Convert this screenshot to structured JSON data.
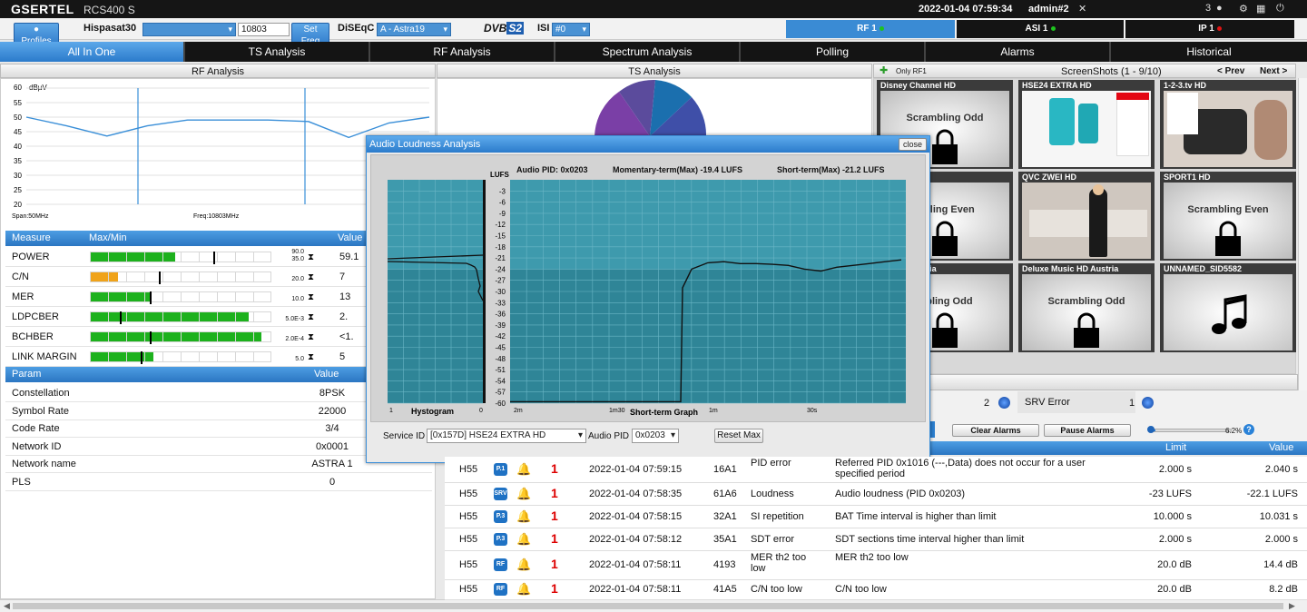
{
  "header": {
    "brand": "GSERTEL",
    "model": "RCS400 S",
    "datetime": "2022-01-04 07:59:34",
    "user": "admin#2",
    "notif_count": "3"
  },
  "toolbar": {
    "profiles": "Profiles",
    "satellite": "Hispasat30",
    "freq_value": "10803",
    "set_freq": "Set Freq",
    "diseqc_label": "DiSEqC",
    "diseqc_value": "A - Astra19",
    "dvb_label": "DVB",
    "dvb_version": "S2",
    "isi_label": "ISI",
    "isi_value": "#0"
  },
  "status_tabs": [
    {
      "label": "RF 1",
      "dot": "#1ec41e"
    },
    {
      "label": "ASI 1",
      "dot": "#1ec41e"
    },
    {
      "label": "IP 1",
      "dot": "#e01414"
    }
  ],
  "nav": [
    "All In One",
    "TS Analysis",
    "RF Analysis",
    "Spectrum Analysis",
    "Polling",
    "Alarms",
    "Historical"
  ],
  "rf": {
    "title": "RF Analysis",
    "y_unit": "dBµV",
    "y_ticks": [
      "60",
      "55",
      "50",
      "45",
      "40",
      "35",
      "30",
      "25",
      "20"
    ],
    "span": "Span:50MHz",
    "freq": "Freq:10803MHz",
    "measure_hdr": "Measure",
    "maxmin_hdr": "Max/Min",
    "value_hdr": "Value",
    "measures": [
      {
        "name": "POWER",
        "max": "90.0",
        "min": "35.0",
        "value": "59.1",
        "fill": 0.47,
        "color": "#1db11d",
        "mark": 0.68
      },
      {
        "name": "C/N",
        "max": "",
        "min": "20.0",
        "value": "7",
        "fill": 0.15,
        "color": "#f0a31a",
        "mark": 0.38
      },
      {
        "name": "MER",
        "max": "",
        "min": "10.0",
        "value": "13",
        "fill": 0.33,
        "color": "#1db11d",
        "mark": 0.33
      },
      {
        "name": "LDPCBER",
        "max": "",
        "min": "5.0E-3",
        "value": "2.",
        "fill": 0.88,
        "color": "#1db11d",
        "mark": 0.16
      },
      {
        "name": "BCHBER",
        "max": "",
        "min": "2.0E-4",
        "value": "<1.",
        "fill": 0.95,
        "color": "#1db11d",
        "mark": 0.33
      },
      {
        "name": "LINK MARGIN",
        "max": "",
        "min": "5.0",
        "value": "5",
        "fill": 0.35,
        "color": "#1db11d",
        "mark": 0.28
      }
    ],
    "param_hdr": "Param",
    "pvalue_hdr": "Value",
    "params": [
      {
        "name": "Constellation",
        "value": "8PSK"
      },
      {
        "name": "Symbol Rate",
        "value": "22000"
      },
      {
        "name": "Code Rate",
        "value": "3/4"
      },
      {
        "name": "Network ID",
        "value": "0x0001"
      },
      {
        "name": "Network name",
        "value": "ASTRA 1"
      },
      {
        "name": "PLS",
        "value": "0"
      }
    ]
  },
  "ts": {
    "title": "TS Analysis"
  },
  "screens": {
    "only_rf": "Only RF1",
    "title": "ScreenShots (1 - 9/10)",
    "prev": "< Prev",
    "next": "Next >",
    "thumbs": [
      {
        "name": "Disney Channel HD",
        "text": "Scrambling Odd",
        "kind": "lock"
      },
      {
        "name": "HSE24 EXTRA HD",
        "text": "",
        "kind": "shop"
      },
      {
        "name": "1-2-3.tv HD",
        "text": "",
        "kind": "shop2"
      },
      {
        "name": "c HD",
        "text": "mbling Even",
        "kind": "lock"
      },
      {
        "name": "QVC ZWEI HD",
        "text": "",
        "kind": "qvc"
      },
      {
        "name": "SPORT1 HD",
        "text": "Scrambling Even",
        "kind": "lock"
      },
      {
        "name": "nel HD Austria",
        "text": "mbling Odd",
        "kind": "lock"
      },
      {
        "name": "Deluxe Music HD Austria",
        "text": "Scrambling Odd",
        "kind": "lock"
      },
      {
        "name": "UNNAMED_SID5582",
        "text": "",
        "kind": "music"
      }
    ]
  },
  "alarm_panel": {
    "count_a": "2",
    "srv_error": "SRV Error",
    "count_b": "1",
    "clear": "Clear Alarms",
    "pause": "Pause Alarms",
    "percent": "6.2%",
    "limit_hdr": "Limit",
    "value_hdr": "Value",
    "rows": [
      {
        "id": "H55",
        "badge": "P.1",
        "bell": "red",
        "count": "1",
        "time": "2022-01-04 07:59:15",
        "code": "16A1",
        "type": "PID error",
        "desc": "Referred PID 0x1016 (---,Data) does not occur for a user specified period",
        "limit": "2.000 s",
        "value": "2.040 s"
      },
      {
        "id": "H55",
        "badge": "SRV",
        "bell": "blue",
        "count": "1",
        "time": "2022-01-04 07:58:35",
        "code": "61A6",
        "type": "Loudness",
        "desc": "Audio loudness (PID 0x0203)",
        "limit": "-23 LUFS",
        "value": "-22.1 LUFS"
      },
      {
        "id": "H55",
        "badge": "P.3",
        "bell": "blue",
        "count": "1",
        "time": "2022-01-04 07:58:15",
        "code": "32A1",
        "type": "SI repetition",
        "desc": "BAT Time interval is higher than limit",
        "limit": "10.000 s",
        "value": "10.031 s"
      },
      {
        "id": "H55",
        "badge": "P.3",
        "bell": "blue",
        "count": "1",
        "time": "2022-01-04 07:58:12",
        "code": "35A1",
        "type": "SDT error",
        "desc": "SDT sections time interval higher than limit",
        "limit": "2.000 s",
        "value": "2.000 s"
      },
      {
        "id": "H55",
        "badge": "RF",
        "bell": "yellow",
        "count": "1",
        "time": "2022-01-04 07:58:11",
        "code": "4193",
        "type": "MER th2 too low",
        "desc": "MER th2 too low",
        "limit": "20.0 dB",
        "value": "14.4 dB"
      },
      {
        "id": "H55",
        "badge": "RF",
        "bell": "yellow",
        "count": "1",
        "time": "2022-01-04 07:58:11",
        "code": "41A5",
        "type": "C/N too low",
        "desc": "C/N too low",
        "limit": "20.0 dB",
        "value": "8.2 dB"
      }
    ]
  },
  "modal": {
    "title": "Audio Loudness Analysis",
    "close": "close",
    "audio_pid": "Audio PID: 0x0203",
    "momentary": "Momentary-term(Max) -19.4 LUFS",
    "short": "Short-term(Max) -21.2 LUFS",
    "lufs": "LUFS",
    "y_ticks": [
      "-3",
      "-6",
      "-9",
      "-12",
      "-15",
      "-18",
      "-21",
      "-24",
      "-27",
      "-30",
      "-33",
      "-36",
      "-39",
      "-42",
      "-45",
      "-48",
      "-51",
      "-54",
      "-57",
      "-60"
    ],
    "hist_left": "1",
    "hist_title": "Hystogram",
    "hist_right": "0",
    "x_labels": [
      "2m",
      "1m30",
      "1m",
      "30s"
    ],
    "graph_title": "Short-term Graph",
    "service_label": "Service ID",
    "service_value": "[0x157D] HSE24 EXTRA HD",
    "audio_label": "Audio PID",
    "audio_value": "0x0203",
    "reset": "Reset Max"
  },
  "chart_data": [
    {
      "type": "line",
      "title": "RF Analysis",
      "ylabel": "dBµV",
      "ylim": [
        20,
        60
      ],
      "x": [
        0,
        5,
        10,
        15,
        20,
        25,
        30,
        35,
        40,
        45,
        50
      ],
      "series": [
        {
          "values": [
            50,
            47,
            43.5,
            47,
            49,
            49,
            49,
            48.5,
            43,
            48,
            50
          ]
        }
      ]
    },
    {
      "type": "line",
      "title": "Short-term Graph",
      "ylabel": "LUFS",
      "ylim": [
        -60,
        0
      ],
      "xlabels": [
        "2m",
        "1m30",
        "1m",
        "30s"
      ],
      "series": [
        {
          "values": [
            -60,
            -60,
            -60,
            -60,
            -60,
            -60,
            -60,
            -60,
            -60,
            -29,
            -24,
            -22.3,
            -22,
            -22.5,
            -22.5,
            -22.7,
            -23,
            -24,
            -24.5,
            -23.5,
            -23,
            -22.5,
            -22,
            -21.5
          ]
        }
      ]
    }
  ]
}
